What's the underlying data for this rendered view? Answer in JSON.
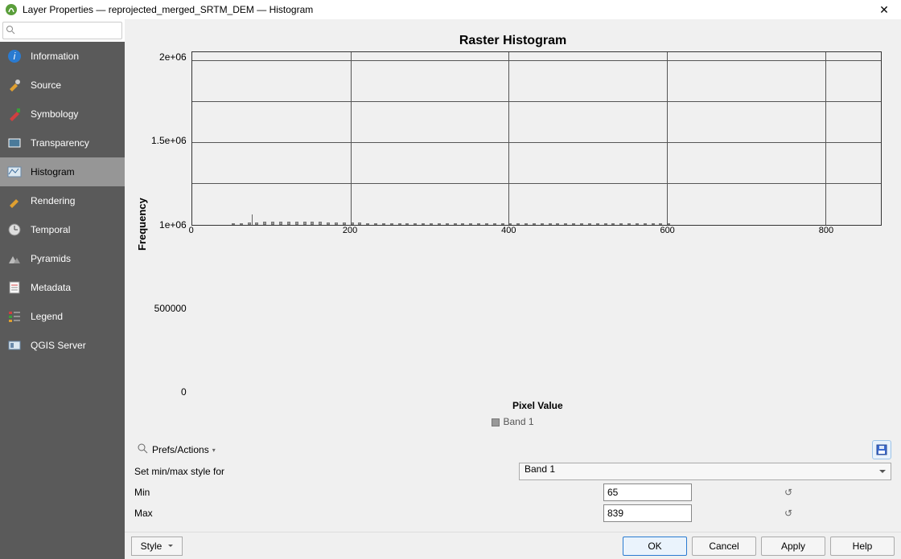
{
  "titlebar": {
    "title": "Layer Properties — reprojected_merged_SRTM_DEM — Histogram"
  },
  "search": {
    "placeholder": ""
  },
  "sidebar": {
    "items": [
      {
        "label": "Information"
      },
      {
        "label": "Source"
      },
      {
        "label": "Symbology"
      },
      {
        "label": "Transparency"
      },
      {
        "label": "Histogram"
      },
      {
        "label": "Rendering"
      },
      {
        "label": "Temporal"
      },
      {
        "label": "Pyramids"
      },
      {
        "label": "Metadata"
      },
      {
        "label": "Legend"
      },
      {
        "label": "QGIS Server"
      }
    ],
    "active_index": 4
  },
  "chart": {
    "title": "Raster Histogram",
    "xlabel": "Pixel Value",
    "ylabel": "Frequency",
    "legend": "Band 1"
  },
  "controls": {
    "prefs_label": "Prefs/Actions",
    "setminmax_label": "Set min/max style for",
    "band_selected": "Band 1",
    "min_label": "Min",
    "min_value": "65",
    "max_label": "Max",
    "max_value": "839"
  },
  "footer": {
    "style": "Style",
    "ok": "OK",
    "cancel": "Cancel",
    "apply": "Apply",
    "help": "Help"
  },
  "chart_data": {
    "type": "bar",
    "title": "Raster Histogram",
    "xlabel": "Pixel Value",
    "ylabel": "Frequency",
    "xlim": [
      0,
      870
    ],
    "ylim": [
      0,
      2100000
    ],
    "xticks": [
      0,
      200,
      400,
      600,
      800
    ],
    "yticks": [
      0,
      500000,
      1000000,
      1500000,
      2000000
    ],
    "ytick_labels": [
      "0",
      "500000",
      "1e+06",
      "1.5e+06",
      "2e+06"
    ],
    "series": [
      {
        "name": "Band 1",
        "x": [
          50,
          60,
          70,
          80,
          90,
          100,
          110,
          120,
          130,
          140,
          150,
          160,
          170,
          180,
          190,
          200,
          210,
          220,
          230,
          240,
          250,
          260,
          270,
          280,
          290,
          300,
          310,
          320,
          330,
          340,
          350,
          360,
          370,
          380,
          390,
          400,
          410,
          420,
          430,
          440,
          450,
          460,
          470,
          480,
          490,
          500,
          510,
          520,
          530,
          540,
          550,
          560,
          570,
          580,
          590,
          600
        ],
        "values": [
          4000,
          8000,
          20000,
          28000,
          32000,
          36000,
          38000,
          38000,
          36000,
          34000,
          32000,
          30000,
          28000,
          26000,
          24000,
          22000,
          20000,
          18000,
          18000,
          16000,
          16000,
          14000,
          14000,
          12000,
          12000,
          10000,
          10000,
          8000,
          8000,
          8000,
          6000,
          6000,
          6000,
          4000,
          4000,
          4000,
          4000,
          2000,
          2000,
          2000,
          2000,
          2000,
          2000,
          2000,
          2000,
          2000,
          2000,
          2000,
          2000,
          2000,
          2000,
          2000,
          2000,
          2000,
          2000,
          2000
        ]
      }
    ],
    "spike": {
      "x": 75,
      "value": 120000
    }
  }
}
